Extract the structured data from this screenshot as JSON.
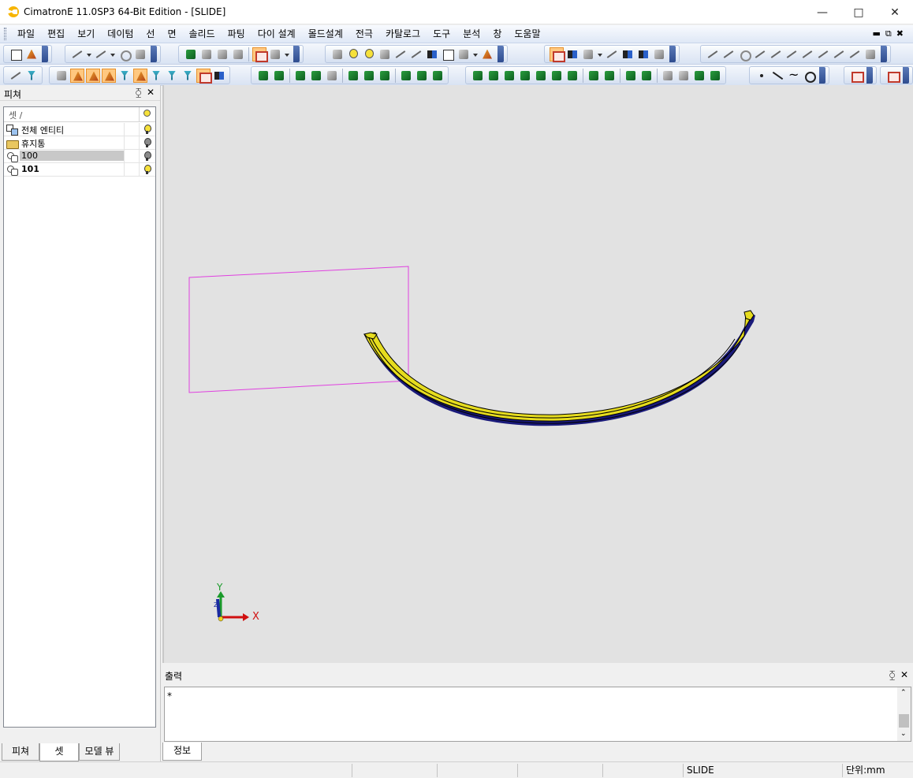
{
  "window": {
    "title": "CimatronE 11.0SP3 64-Bit Edition - [SLIDE]",
    "minimize_icon": "minimize-icon",
    "maximize_icon": "maximize-icon",
    "close_icon": "close-icon"
  },
  "menu": [
    "파일",
    "편집",
    "보기",
    "데이텀",
    "선",
    "면",
    "솔리드",
    "파팅",
    "다이 설계",
    "몰드설계",
    "전극",
    "카탈로그",
    "도구",
    "분석",
    "창",
    "도움말"
  ],
  "left_panel": {
    "title": "피쳐",
    "column_header": "셋 /",
    "rows": [
      {
        "label": "전체 엔티티",
        "icon": "all-entities-icon",
        "light": "on"
      },
      {
        "label": "휴지통",
        "icon": "trash-bin-icon",
        "light": "off"
      },
      {
        "label": "100",
        "icon": "set-icon",
        "light": "off",
        "selected": true
      },
      {
        "label": "101",
        "icon": "set-icon",
        "light": "on",
        "bold": true
      }
    ],
    "tabs": [
      "피쳐",
      "셋",
      "모델 뷰"
    ],
    "active_tab": "셋"
  },
  "viewport": {
    "axis_x": "X",
    "axis_y": "Y",
    "axis_z": "Z",
    "colors": {
      "background": "#e2e2e2",
      "rectangle": "#e040e0",
      "part_fill": "#e6dc1e",
      "part_edge": "#000000",
      "part_shadow": "#1a1a7a"
    }
  },
  "output_panel": {
    "title": "출력",
    "content": "*",
    "tab": "정보"
  },
  "statusbar": {
    "mode": "SLIDE",
    "units": "단위:mm"
  }
}
